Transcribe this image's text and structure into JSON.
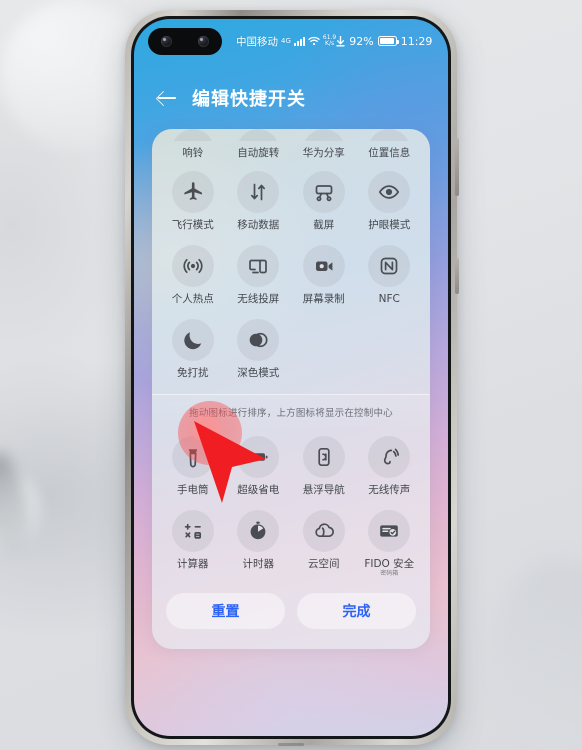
{
  "status_bar": {
    "carrier": "中国移动",
    "network_type": "4G",
    "net_speed_value": "61.9",
    "net_speed_unit": "K/s",
    "battery_percent": "92%",
    "time": "11:29",
    "download_icon": "download-arrow-icon",
    "signal_icon": "signal-bars-icon",
    "wifi_icon": "wifi-icon",
    "battery_icon": "battery-icon"
  },
  "header": {
    "back_icon": "back-arrow-icon",
    "title": "编辑快捷开关"
  },
  "card": {
    "row_top": [
      {
        "label": "响铃",
        "icon": "bell-icon"
      },
      {
        "label": "自动旋转",
        "icon": "auto-rotate-icon"
      },
      {
        "label": "华为分享",
        "icon": "huawei-share-icon"
      },
      {
        "label": "位置信息",
        "icon": "location-icon"
      }
    ],
    "active_tiles": [
      {
        "label": "飞行模式",
        "icon": "airplane-icon"
      },
      {
        "label": "移动数据",
        "icon": "mobile-data-icon"
      },
      {
        "label": "截屏",
        "icon": "screenshot-icon"
      },
      {
        "label": "护眼模式",
        "icon": "eye-comfort-icon"
      },
      {
        "label": "个人热点",
        "icon": "hotspot-icon"
      },
      {
        "label": "无线投屏",
        "icon": "cast-screen-icon"
      },
      {
        "label": "屏幕录制",
        "icon": "screen-record-icon"
      },
      {
        "label": "NFC",
        "icon": "nfc-icon"
      },
      {
        "label": "免打扰",
        "icon": "moon-icon"
      },
      {
        "label": "深色模式",
        "icon": "dark-mode-icon"
      }
    ],
    "hint_text": "拖动图标进行排序，上方图标将显示在控制中心",
    "inactive_tiles": [
      {
        "label": "手电筒",
        "icon": "flashlight-icon"
      },
      {
        "label": "超级省电",
        "icon": "super-power-saving-icon"
      },
      {
        "label": "悬浮导航",
        "icon": "floating-navigation-icon"
      },
      {
        "label": "无线传声",
        "icon": "wireless-sound-icon"
      },
      {
        "label": "计算器",
        "icon": "calculator-icon"
      },
      {
        "label": "计时器",
        "icon": "timer-icon"
      },
      {
        "label": "云空间",
        "icon": "cloud-icon"
      },
      {
        "label": "FIDO 安全",
        "sub": "密码箱",
        "icon": "fido-security-icon"
      }
    ],
    "reset_label": "重置",
    "done_label": "完成"
  },
  "colors": {
    "accent_blue": "#2c62f6",
    "cursor_red": "#f01e22",
    "tile_bubble": "rgba(160,160,168,0.20)",
    "label_gray": "#44474c"
  },
  "cursor": {
    "arrow_icon": "mouse-cursor-arrow-icon",
    "tap_icon": "tap-ripple-icon"
  }
}
